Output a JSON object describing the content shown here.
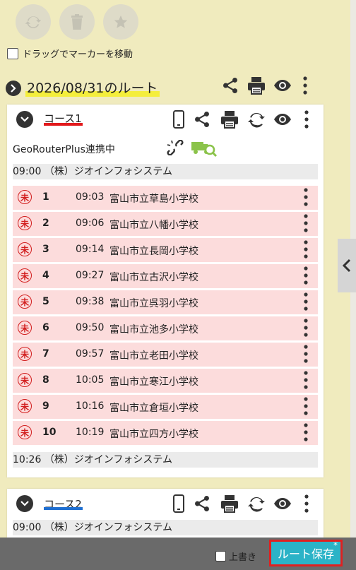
{
  "options": {
    "drag_marker_label": "ドラッグでマーカーを移動"
  },
  "route": {
    "title": "2026/08/31のルート"
  },
  "course1": {
    "title": "コース1",
    "line_color": "#e2191c",
    "georouter_label": "GeoRouterPlus連携中",
    "start": {
      "time": "09:00",
      "name": "（株）ジオインフォシステム"
    },
    "end": {
      "time": "10:26",
      "name": "（株）ジオインフォシステム"
    },
    "stops": [
      {
        "status": "未",
        "num": "1",
        "time": "09:03",
        "name": "富山市立草島小学校"
      },
      {
        "status": "未",
        "num": "2",
        "time": "09:06",
        "name": "富山市立八幡小学校"
      },
      {
        "status": "未",
        "num": "3",
        "time": "09:14",
        "name": "富山市立長岡小学校"
      },
      {
        "status": "未",
        "num": "4",
        "time": "09:27",
        "name": "富山市立古沢小学校"
      },
      {
        "status": "未",
        "num": "5",
        "time": "09:38",
        "name": "富山市立呉羽小学校"
      },
      {
        "status": "未",
        "num": "6",
        "time": "09:50",
        "name": "富山市立池多小学校"
      },
      {
        "status": "未",
        "num": "7",
        "time": "09:57",
        "name": "富山市立老田小学校"
      },
      {
        "status": "未",
        "num": "8",
        "time": "10:05",
        "name": "富山市立寒江小学校"
      },
      {
        "status": "未",
        "num": "9",
        "time": "10:16",
        "name": "富山市立倉垣小学校"
      },
      {
        "status": "未",
        "num": "10",
        "time": "10:19",
        "name": "富山市立四方小学校"
      }
    ]
  },
  "course2": {
    "title": "コース2",
    "line_color": "#1f6fd1",
    "start": {
      "time": "09:00",
      "name": "（株）ジオインフォシステム"
    }
  },
  "footer": {
    "overwrite_label": "上書き",
    "save_label": "ルート保存",
    "save_marker": "*"
  },
  "icons": {
    "top_actions": [
      "refresh-icon",
      "trash-icon",
      "star-icon"
    ],
    "route_actions": [
      "share-icon",
      "print-icon",
      "eye-icon",
      "more-vertical-icon"
    ],
    "course_actions": [
      "mobile-phone-icon",
      "share-icon",
      "print-icon",
      "sync-icon",
      "eye-icon",
      "more-vertical-icon"
    ],
    "georouter": [
      "unlink-icon",
      "truck-search-icon"
    ]
  }
}
